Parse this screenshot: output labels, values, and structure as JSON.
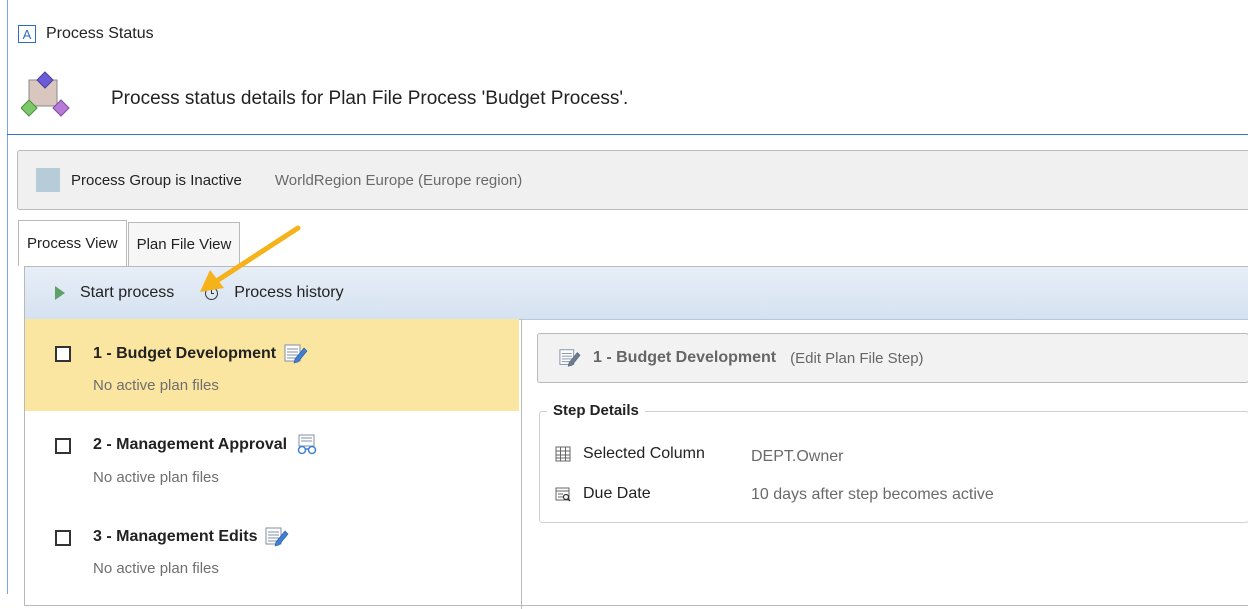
{
  "window": {
    "app_icon_letter": "A",
    "title": "Process Status"
  },
  "header": {
    "text": "Process status details for Plan File Process 'Budget Process'."
  },
  "group": {
    "status": "Process Group is Inactive",
    "region": "WorldRegion Europe (Europe region)",
    "swatch_color": "#b7ccd9"
  },
  "tabs": [
    {
      "label": "Process View"
    },
    {
      "label": "Plan File View"
    }
  ],
  "toolbar": {
    "start_label": "Start process",
    "history_label": "Process history"
  },
  "steps": [
    {
      "title": "1 - Budget Development",
      "subtitle": "No active plan files",
      "icon": "edit-plan-file-icon",
      "selected": true
    },
    {
      "title": "2 - Management Approval",
      "subtitle": "No active plan files",
      "icon": "approval-icon",
      "selected": false
    },
    {
      "title": "3 - Management Edits",
      "subtitle": "No active plan files",
      "icon": "edit-plan-file-icon",
      "selected": false
    }
  ],
  "detail": {
    "title": "1 - Budget Development",
    "type": "(Edit Plan File Step)",
    "section_label": "Step Details",
    "rows": [
      {
        "label": "Selected Column",
        "value": "DEPT.Owner",
        "icon": "table-icon"
      },
      {
        "label": "Due Date",
        "value": "10 days after step becomes active",
        "icon": "calendar-icon"
      }
    ]
  },
  "colors": {
    "accent": "#2e75c8",
    "selected_row": "#fbe6a1",
    "callout_arrow": "#f5b21b",
    "play": "#5fa06a"
  }
}
